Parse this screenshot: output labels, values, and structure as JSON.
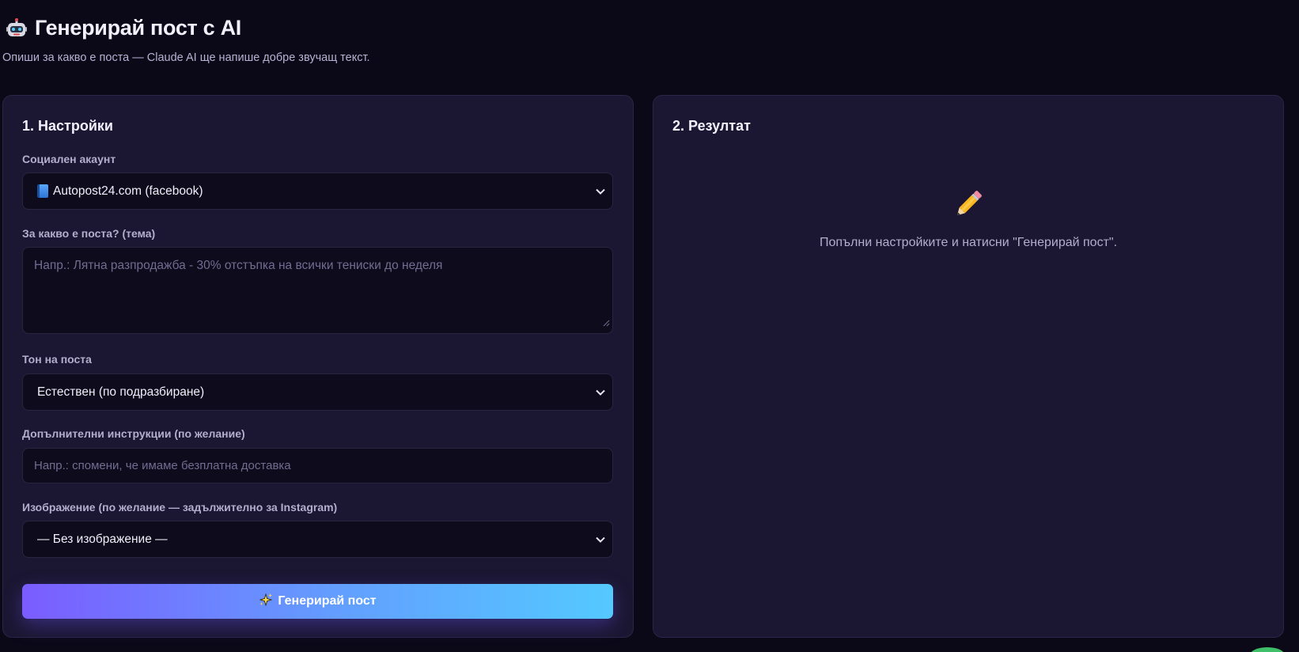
{
  "header": {
    "title": "Генерирай пост с AI",
    "subtitle": "Опиши за какво е поста — Claude AI ще напише добре звучащ текст."
  },
  "settings": {
    "heading": "1. Настройки",
    "account": {
      "label": "Социален акаунт",
      "value": "Autopost24.com (facebook)",
      "icon": "facebook-book-icon"
    },
    "topic": {
      "label": "За какво е поста? (тема)",
      "placeholder": "Напр.: Лятна разпродажба - 30% отстъпка на всички тениски до неделя"
    },
    "tone": {
      "label": "Тон на поста",
      "value": "Естествен (по подразбиране)"
    },
    "instructions": {
      "label": "Допълнителни инструкции (по желание)",
      "placeholder": "Напр.: спомени, че имаме безплатна доставка"
    },
    "image": {
      "label": "Изображение (по желание — задължително за Instagram)",
      "value": "— Без изображение —"
    },
    "generate_button": "Генерирай пост"
  },
  "result": {
    "heading": "2. Резултат",
    "empty_message": "Попълни настройките и натисни \"Генерирай пост\"."
  },
  "colors": {
    "background": "#0b0918",
    "panel": "#1b1631",
    "button_gradient_start": "#7b5cff",
    "button_gradient_end": "#54c9ff"
  }
}
